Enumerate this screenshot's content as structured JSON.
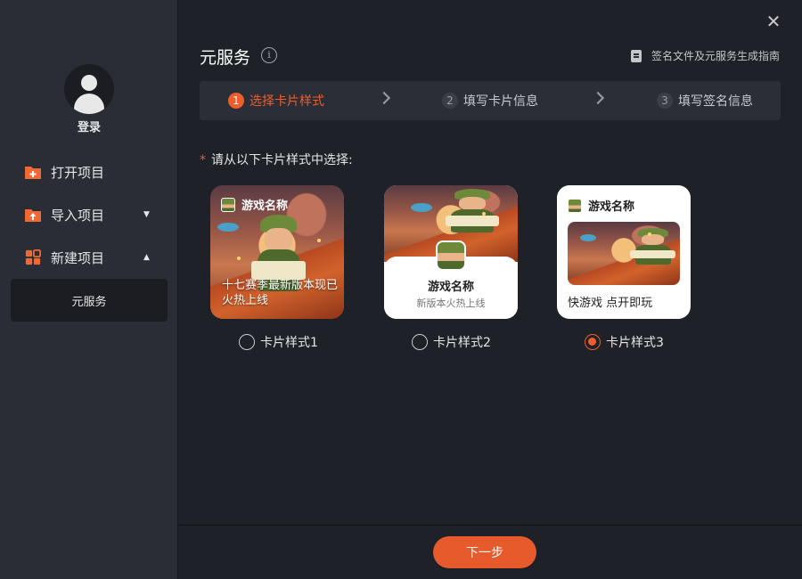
{
  "window": {
    "close_icon": "close-icon",
    "close_glyph": "✕"
  },
  "sidebar": {
    "login_label": "登录",
    "items": [
      {
        "label": "打开项目",
        "icon": "folder-open-icon"
      },
      {
        "label": "导入项目",
        "icon": "folder-import-icon",
        "caret": "▼"
      },
      {
        "label": "新建项目",
        "icon": "grid-new-icon",
        "caret": "▲"
      }
    ],
    "sub_item": "元服务"
  },
  "header": {
    "title": "元服务",
    "info_glyph": "i",
    "guide_link": "签名文件及元服务生成指南"
  },
  "steps": [
    {
      "num": "1",
      "label": "选择卡片样式",
      "state": "active"
    },
    {
      "num": "2",
      "label": "填写卡片信息",
      "state": "inactive"
    },
    {
      "num": "3",
      "label": "填写签名信息",
      "state": "inactive"
    }
  ],
  "prompt": {
    "required_mark": "*",
    "text": "请从以下卡片样式中选择:"
  },
  "cards": {
    "card1": {
      "game_name": "游戏名称",
      "desc": "十七赛季最新版本现已火热上线"
    },
    "card2": {
      "game_name": "游戏名称",
      "desc": "新版本火热上线"
    },
    "card3": {
      "game_name": "游戏名称",
      "tagline": "快游戏  点开即玩"
    }
  },
  "options": [
    {
      "label": "卡片样式1",
      "checked": false
    },
    {
      "label": "卡片样式2",
      "checked": false
    },
    {
      "label": "卡片样式3",
      "checked": true
    }
  ],
  "footer": {
    "next_label": "下一步"
  },
  "colors": {
    "accent": "#ee5d2c",
    "background": "#1f2128",
    "sidebar": "#2a2d35"
  }
}
